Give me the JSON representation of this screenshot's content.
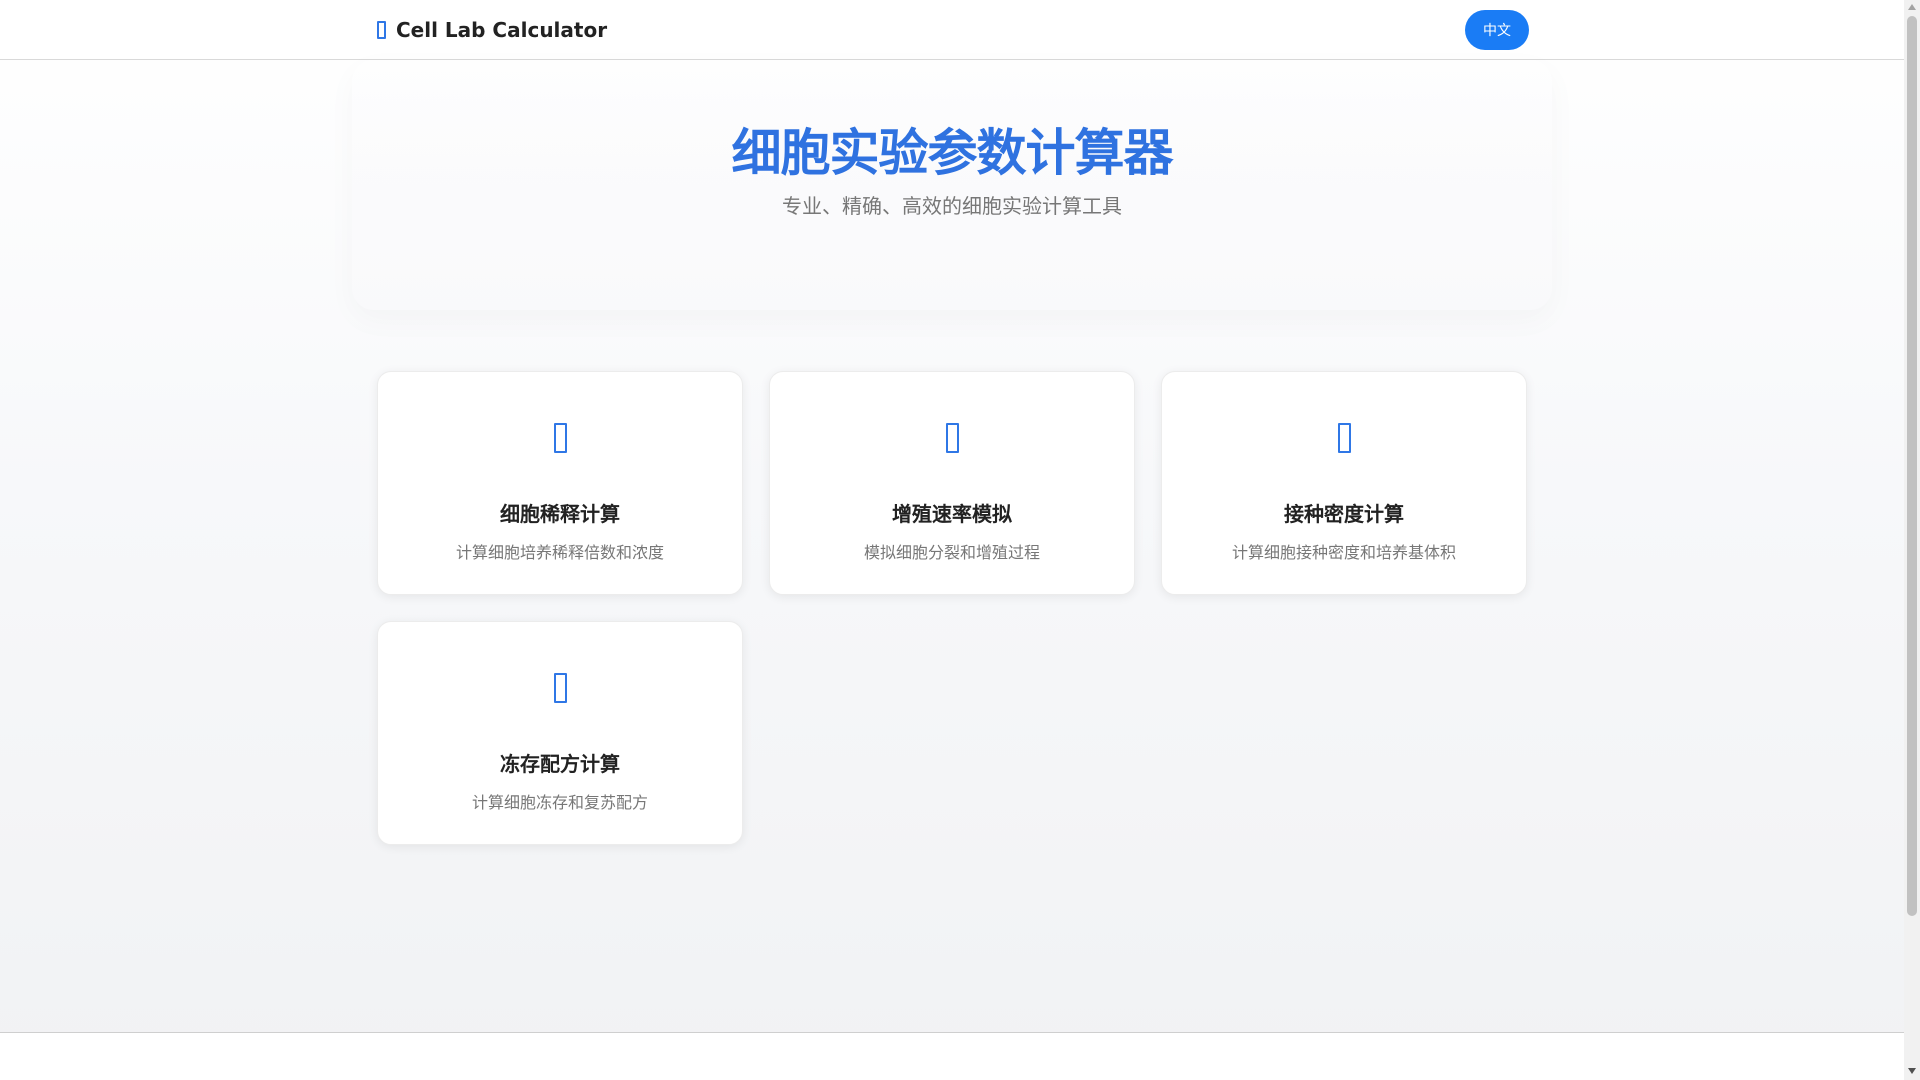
{
  "header": {
    "brand_icon": "flask-icon",
    "brand_title": "Cell Lab Calculator",
    "language_button": "中文"
  },
  "hero": {
    "title": "细胞实验参数计算器",
    "subtitle": "专业、精确、高效的细胞实验计算工具"
  },
  "cards": [
    {
      "icon": "dilution-icon",
      "title": "细胞稀释计算",
      "description": "计算细胞培养稀释倍数和浓度"
    },
    {
      "icon": "growth-icon",
      "title": "增殖速率模拟",
      "description": "模拟细胞分裂和增殖过程"
    },
    {
      "icon": "seeding-icon",
      "title": "接种密度计算",
      "description": "计算细胞接种密度和培养基体积"
    },
    {
      "icon": "freezing-icon",
      "title": "冻存配方计算",
      "description": "计算细胞冻存和复苏配方"
    }
  ],
  "colors": {
    "accent": "#1a7cf5",
    "title_blue": "#2f72e0"
  }
}
